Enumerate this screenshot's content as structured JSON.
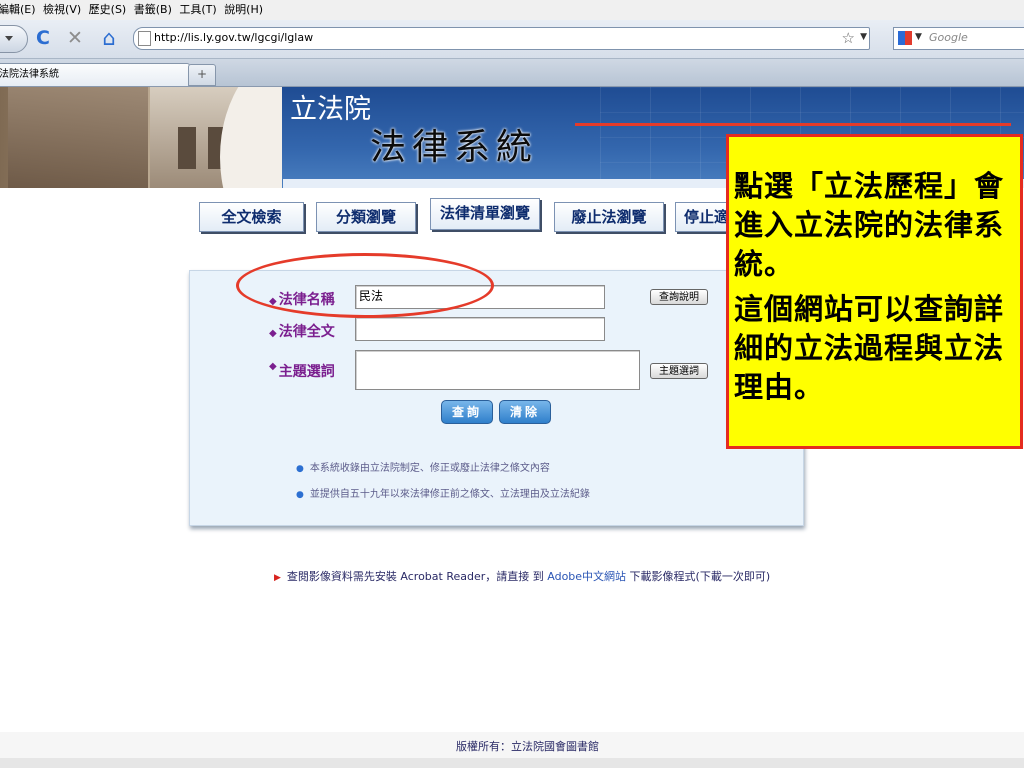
{
  "menubar": {
    "items": [
      "編輯(E)",
      "檢視(V)",
      "歷史(S)",
      "書籤(B)",
      "工具(T)",
      "說明(H)"
    ]
  },
  "toolbar": {
    "reload_icon": "C",
    "stop_icon": "✕",
    "home_icon": "⌂",
    "url": "http://lis.ly.gov.tw/lgcgi/lglaw",
    "star_icon": "☆",
    "search_placeholder": "Google"
  },
  "tabs": {
    "active_title": "法院法律系統",
    "new_tab_icon": "+"
  },
  "banner": {
    "org": "立法院",
    "system": "法律系統"
  },
  "nav_tabs": [
    "全文檢索",
    "分類瀏覽",
    "法律清單瀏覽",
    "廢止法瀏覽",
    "停止適用"
  ],
  "search": {
    "law_name_label": "法律名稱",
    "law_name_value": "民法",
    "law_text_label": "法律全文",
    "law_text_value": "",
    "subject_label": "主題選詞",
    "subject_value": "",
    "help_button": "查詢說明",
    "subject_button": "主題選詞",
    "query_button": "查詢",
    "clear_button": "清除",
    "notes": [
      "本系統收錄由立法院制定、修正或廢止法律之條文內容",
      "並提供自五十九年以來法律修正前之條文、立法理由及立法紀錄"
    ]
  },
  "instructions": {
    "prefix": "查閱影像資料需先安裝 Acrobat Reader，請直接 到 ",
    "link": "Adobe中文網站",
    "suffix": " 下載影像程式(下載一次即可)"
  },
  "footer": {
    "copyright": "版權所有：立法院國會圖書館"
  },
  "callout": {
    "para1": "點選「立法歷程」會進入立法院的法律系統。",
    "para2": "這個網站可以查詢詳細的立法過程與立法理由。"
  },
  "colors": {
    "callout_bg": "#ffff00",
    "annotation_red": "#e53b2a",
    "label_purple": "#7b1f8f",
    "banner_blue": "#1f4c93"
  }
}
